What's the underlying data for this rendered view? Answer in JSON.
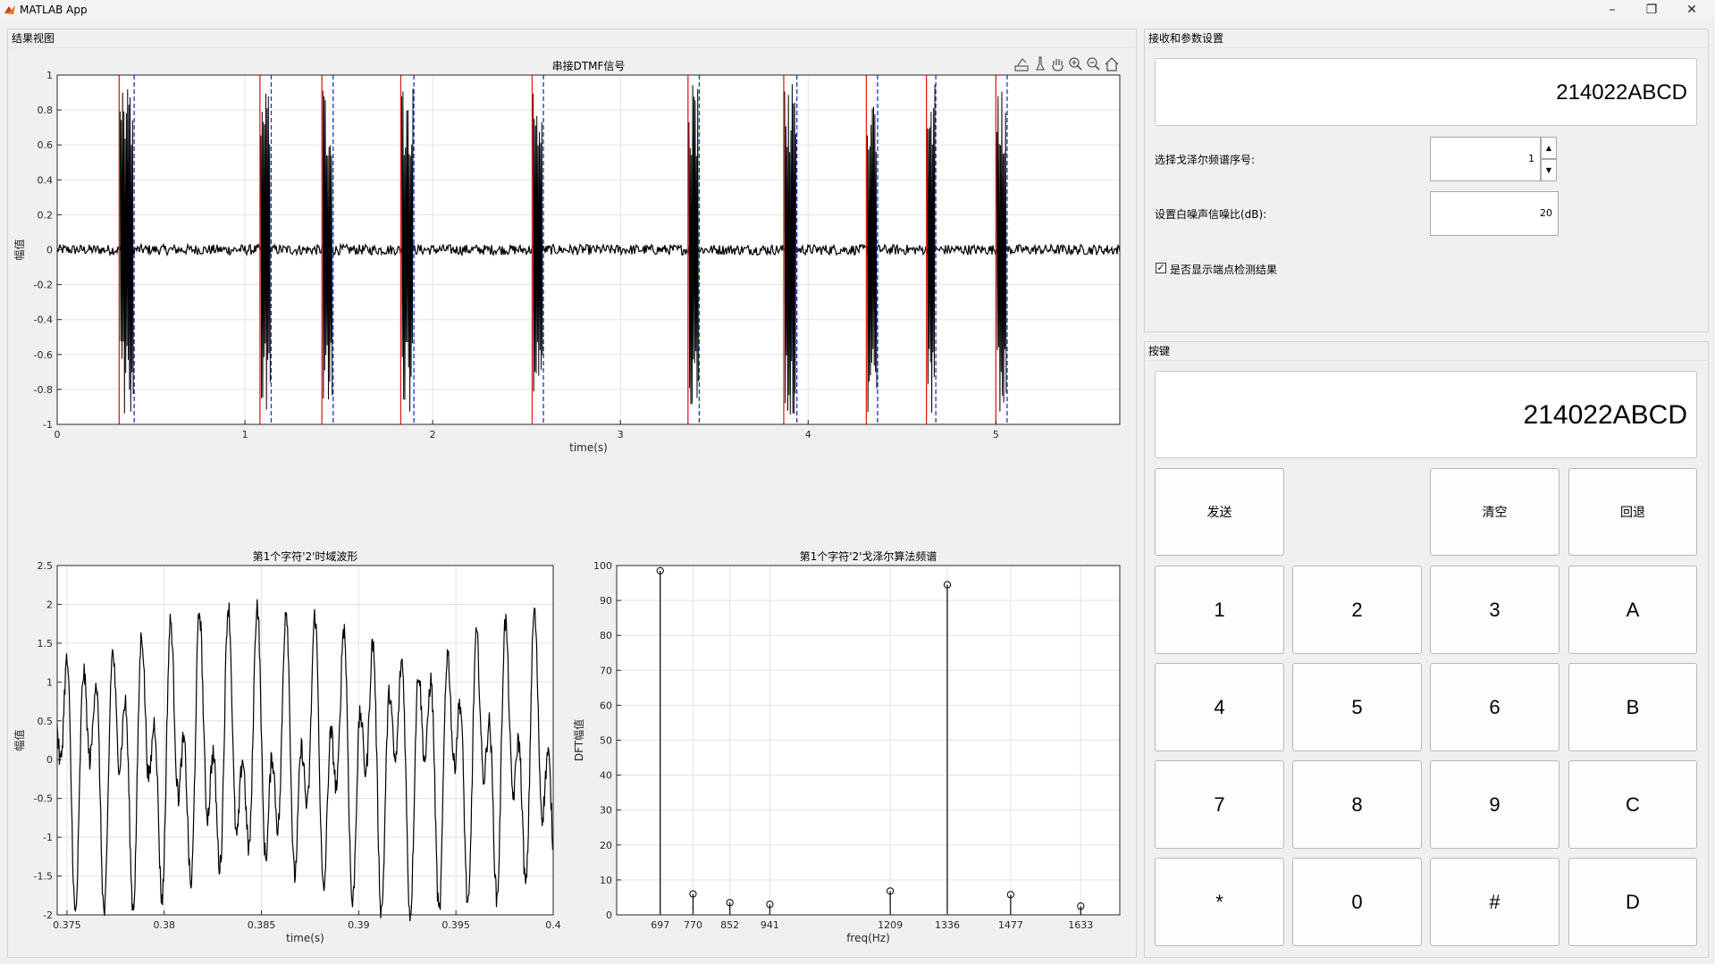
{
  "window": {
    "title": "MATLAB App",
    "minimize": "–",
    "maximize": "❐",
    "close": "✕"
  },
  "results_panel": {
    "title": "结果视图",
    "axes_toolbar": [
      "export-icon",
      "brush-icon",
      "pan-icon",
      "zoom-in-icon",
      "zoom-out-icon",
      "home-icon"
    ]
  },
  "settings_panel": {
    "title": "接收和参数设置",
    "received_display": "214022ABCD",
    "spectrum_index_label": "选择戈泽尔频谱序号:",
    "spectrum_index_value": "1",
    "snr_label": "设置白噪声信噪比(dB):",
    "snr_value": "20",
    "show_endpoint_checked": true,
    "show_endpoint_label": "是否显示端点检测结果"
  },
  "keypad_panel": {
    "title": "按键",
    "display": "214022ABCD",
    "send": "发送",
    "clear": "清空",
    "backspace": "回退",
    "keys": [
      [
        "1",
        "2",
        "3",
        "A"
      ],
      [
        "4",
        "5",
        "6",
        "B"
      ],
      [
        "7",
        "8",
        "9",
        "C"
      ],
      [
        "*",
        "0",
        "#",
        "D"
      ]
    ]
  },
  "colors": {
    "start_marker": "#e02020",
    "end_marker": "#2030d0",
    "signal": "#000000"
  },
  "chart_data": [
    {
      "type": "line",
      "title": "串接DTMF信号",
      "xlabel": "time(s)",
      "ylabel": "幅值",
      "xlim": [
        0,
        5.66
      ],
      "ylim": [
        -1,
        1
      ],
      "xticks": [
        0,
        1,
        2,
        3,
        4,
        5
      ],
      "yticks": [
        -1,
        -0.8,
        -0.6,
        -0.4,
        -0.2,
        0,
        0.2,
        0.4,
        0.6,
        0.8,
        1
      ],
      "grid": true,
      "tone_bursts": [
        {
          "start": 0.33,
          "end": 0.41
        },
        {
          "start": 1.08,
          "end": 1.14
        },
        {
          "start": 1.41,
          "end": 1.47
        },
        {
          "start": 1.83,
          "end": 1.9
        },
        {
          "start": 2.53,
          "end": 2.59
        },
        {
          "start": 3.36,
          "end": 3.42
        },
        {
          "start": 3.87,
          "end": 3.94
        },
        {
          "start": 4.31,
          "end": 4.37
        },
        {
          "start": 4.63,
          "end": 4.68
        },
        {
          "start": 5.0,
          "end": 5.06
        }
      ],
      "endpoint_start_markers": [
        0.33,
        1.08,
        1.41,
        1.83,
        2.53,
        3.36,
        3.87,
        4.31,
        4.63,
        5.0
      ],
      "endpoint_end_markers": [
        0.41,
        1.14,
        1.47,
        1.9,
        2.59,
        3.42,
        3.94,
        4.37,
        4.68,
        5.06
      ],
      "noise_amplitude": 0.03,
      "burst_amplitude": 0.95
    },
    {
      "type": "line",
      "title": "第1个字符'2'时域波形",
      "xlabel": "time(s)",
      "ylabel": "幅值",
      "xlim": [
        0.3745,
        0.4
      ],
      "ylim": [
        -2,
        2.5
      ],
      "xticks": [
        0.375,
        0.38,
        0.385,
        0.39,
        0.395,
        0.4
      ],
      "xtick_labels": [
        "0.375",
        "0.38",
        "0.385",
        "0.39",
        "0.395",
        "0.4"
      ],
      "yticks": [
        -2,
        -1.5,
        -1,
        -0.5,
        0,
        0.5,
        1,
        1.5,
        2,
        2.5
      ],
      "grid": true,
      "signal_frequencies_hz": [
        697,
        1336
      ]
    },
    {
      "type": "stem",
      "title": "第1个字符'2'戈泽尔算法频谱",
      "xlabel": "freq(Hz)",
      "ylabel": "DFT幅值",
      "xlim": [
        600,
        1720
      ],
      "ylim": [
        0,
        100
      ],
      "categories": [
        "697",
        "770",
        "852",
        "941",
        "1209",
        "1336",
        "1477",
        "1633"
      ],
      "x": [
        697,
        770,
        852,
        941,
        1209,
        1336,
        1477,
        1633
      ],
      "values": [
        98.5,
        6,
        3.5,
        3,
        6.8,
        94.5,
        5.8,
        2.5
      ],
      "yticks": [
        0,
        10,
        20,
        30,
        40,
        50,
        60,
        70,
        80,
        90,
        100
      ],
      "grid": true
    }
  ]
}
